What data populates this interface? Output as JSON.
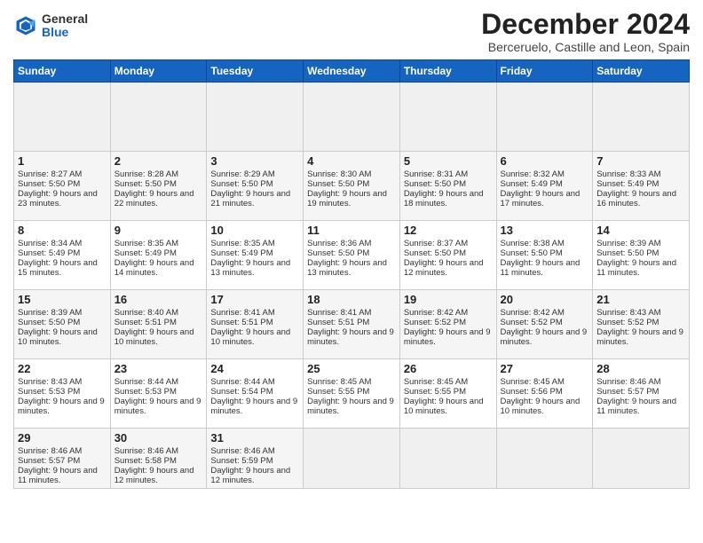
{
  "header": {
    "logo_general": "General",
    "logo_blue": "Blue",
    "title": "December 2024",
    "location": "Berceruelo, Castille and Leon, Spain"
  },
  "calendar": {
    "days_of_week": [
      "Sunday",
      "Monday",
      "Tuesday",
      "Wednesday",
      "Thursday",
      "Friday",
      "Saturday"
    ],
    "weeks": [
      [
        {
          "day": "",
          "empty": true
        },
        {
          "day": "",
          "empty": true
        },
        {
          "day": "",
          "empty": true
        },
        {
          "day": "",
          "empty": true
        },
        {
          "day": "",
          "empty": true
        },
        {
          "day": "",
          "empty": true
        },
        {
          "day": "",
          "empty": true
        }
      ],
      [
        {
          "day": "1",
          "sunrise": "Sunrise: 8:27 AM",
          "sunset": "Sunset: 5:50 PM",
          "daylight": "Daylight: 9 hours and 23 minutes."
        },
        {
          "day": "2",
          "sunrise": "Sunrise: 8:28 AM",
          "sunset": "Sunset: 5:50 PM",
          "daylight": "Daylight: 9 hours and 22 minutes."
        },
        {
          "day": "3",
          "sunrise": "Sunrise: 8:29 AM",
          "sunset": "Sunset: 5:50 PM",
          "daylight": "Daylight: 9 hours and 21 minutes."
        },
        {
          "day": "4",
          "sunrise": "Sunrise: 8:30 AM",
          "sunset": "Sunset: 5:50 PM",
          "daylight": "Daylight: 9 hours and 19 minutes."
        },
        {
          "day": "5",
          "sunrise": "Sunrise: 8:31 AM",
          "sunset": "Sunset: 5:50 PM",
          "daylight": "Daylight: 9 hours and 18 minutes."
        },
        {
          "day": "6",
          "sunrise": "Sunrise: 8:32 AM",
          "sunset": "Sunset: 5:49 PM",
          "daylight": "Daylight: 9 hours and 17 minutes."
        },
        {
          "day": "7",
          "sunrise": "Sunrise: 8:33 AM",
          "sunset": "Sunset: 5:49 PM",
          "daylight": "Daylight: 9 hours and 16 minutes."
        }
      ],
      [
        {
          "day": "8",
          "sunrise": "Sunrise: 8:34 AM",
          "sunset": "Sunset: 5:49 PM",
          "daylight": "Daylight: 9 hours and 15 minutes."
        },
        {
          "day": "9",
          "sunrise": "Sunrise: 8:35 AM",
          "sunset": "Sunset: 5:49 PM",
          "daylight": "Daylight: 9 hours and 14 minutes."
        },
        {
          "day": "10",
          "sunrise": "Sunrise: 8:35 AM",
          "sunset": "Sunset: 5:49 PM",
          "daylight": "Daylight: 9 hours and 13 minutes."
        },
        {
          "day": "11",
          "sunrise": "Sunrise: 8:36 AM",
          "sunset": "Sunset: 5:50 PM",
          "daylight": "Daylight: 9 hours and 13 minutes."
        },
        {
          "day": "12",
          "sunrise": "Sunrise: 8:37 AM",
          "sunset": "Sunset: 5:50 PM",
          "daylight": "Daylight: 9 hours and 12 minutes."
        },
        {
          "day": "13",
          "sunrise": "Sunrise: 8:38 AM",
          "sunset": "Sunset: 5:50 PM",
          "daylight": "Daylight: 9 hours and 11 minutes."
        },
        {
          "day": "14",
          "sunrise": "Sunrise: 8:39 AM",
          "sunset": "Sunset: 5:50 PM",
          "daylight": "Daylight: 9 hours and 11 minutes."
        }
      ],
      [
        {
          "day": "15",
          "sunrise": "Sunrise: 8:39 AM",
          "sunset": "Sunset: 5:50 PM",
          "daylight": "Daylight: 9 hours and 10 minutes."
        },
        {
          "day": "16",
          "sunrise": "Sunrise: 8:40 AM",
          "sunset": "Sunset: 5:51 PM",
          "daylight": "Daylight: 9 hours and 10 minutes."
        },
        {
          "day": "17",
          "sunrise": "Sunrise: 8:41 AM",
          "sunset": "Sunset: 5:51 PM",
          "daylight": "Daylight: 9 hours and 10 minutes."
        },
        {
          "day": "18",
          "sunrise": "Sunrise: 8:41 AM",
          "sunset": "Sunset: 5:51 PM",
          "daylight": "Daylight: 9 hours and 9 minutes."
        },
        {
          "day": "19",
          "sunrise": "Sunrise: 8:42 AM",
          "sunset": "Sunset: 5:52 PM",
          "daylight": "Daylight: 9 hours and 9 minutes."
        },
        {
          "day": "20",
          "sunrise": "Sunrise: 8:42 AM",
          "sunset": "Sunset: 5:52 PM",
          "daylight": "Daylight: 9 hours and 9 minutes."
        },
        {
          "day": "21",
          "sunrise": "Sunrise: 8:43 AM",
          "sunset": "Sunset: 5:52 PM",
          "daylight": "Daylight: 9 hours and 9 minutes."
        }
      ],
      [
        {
          "day": "22",
          "sunrise": "Sunrise: 8:43 AM",
          "sunset": "Sunset: 5:53 PM",
          "daylight": "Daylight: 9 hours and 9 minutes."
        },
        {
          "day": "23",
          "sunrise": "Sunrise: 8:44 AM",
          "sunset": "Sunset: 5:53 PM",
          "daylight": "Daylight: 9 hours and 9 minutes."
        },
        {
          "day": "24",
          "sunrise": "Sunrise: 8:44 AM",
          "sunset": "Sunset: 5:54 PM",
          "daylight": "Daylight: 9 hours and 9 minutes."
        },
        {
          "day": "25",
          "sunrise": "Sunrise: 8:45 AM",
          "sunset": "Sunset: 5:55 PM",
          "daylight": "Daylight: 9 hours and 9 minutes."
        },
        {
          "day": "26",
          "sunrise": "Sunrise: 8:45 AM",
          "sunset": "Sunset: 5:55 PM",
          "daylight": "Daylight: 9 hours and 10 minutes."
        },
        {
          "day": "27",
          "sunrise": "Sunrise: 8:45 AM",
          "sunset": "Sunset: 5:56 PM",
          "daylight": "Daylight: 9 hours and 10 minutes."
        },
        {
          "day": "28",
          "sunrise": "Sunrise: 8:46 AM",
          "sunset": "Sunset: 5:57 PM",
          "daylight": "Daylight: 9 hours and 11 minutes."
        }
      ],
      [
        {
          "day": "29",
          "sunrise": "Sunrise: 8:46 AM",
          "sunset": "Sunset: 5:57 PM",
          "daylight": "Daylight: 9 hours and 11 minutes."
        },
        {
          "day": "30",
          "sunrise": "Sunrise: 8:46 AM",
          "sunset": "Sunset: 5:58 PM",
          "daylight": "Daylight: 9 hours and 12 minutes."
        },
        {
          "day": "31",
          "sunrise": "Sunrise: 8:46 AM",
          "sunset": "Sunset: 5:59 PM",
          "daylight": "Daylight: 9 hours and 12 minutes."
        },
        {
          "day": "",
          "empty": true
        },
        {
          "day": "",
          "empty": true
        },
        {
          "day": "",
          "empty": true
        },
        {
          "day": "",
          "empty": true
        }
      ]
    ]
  }
}
